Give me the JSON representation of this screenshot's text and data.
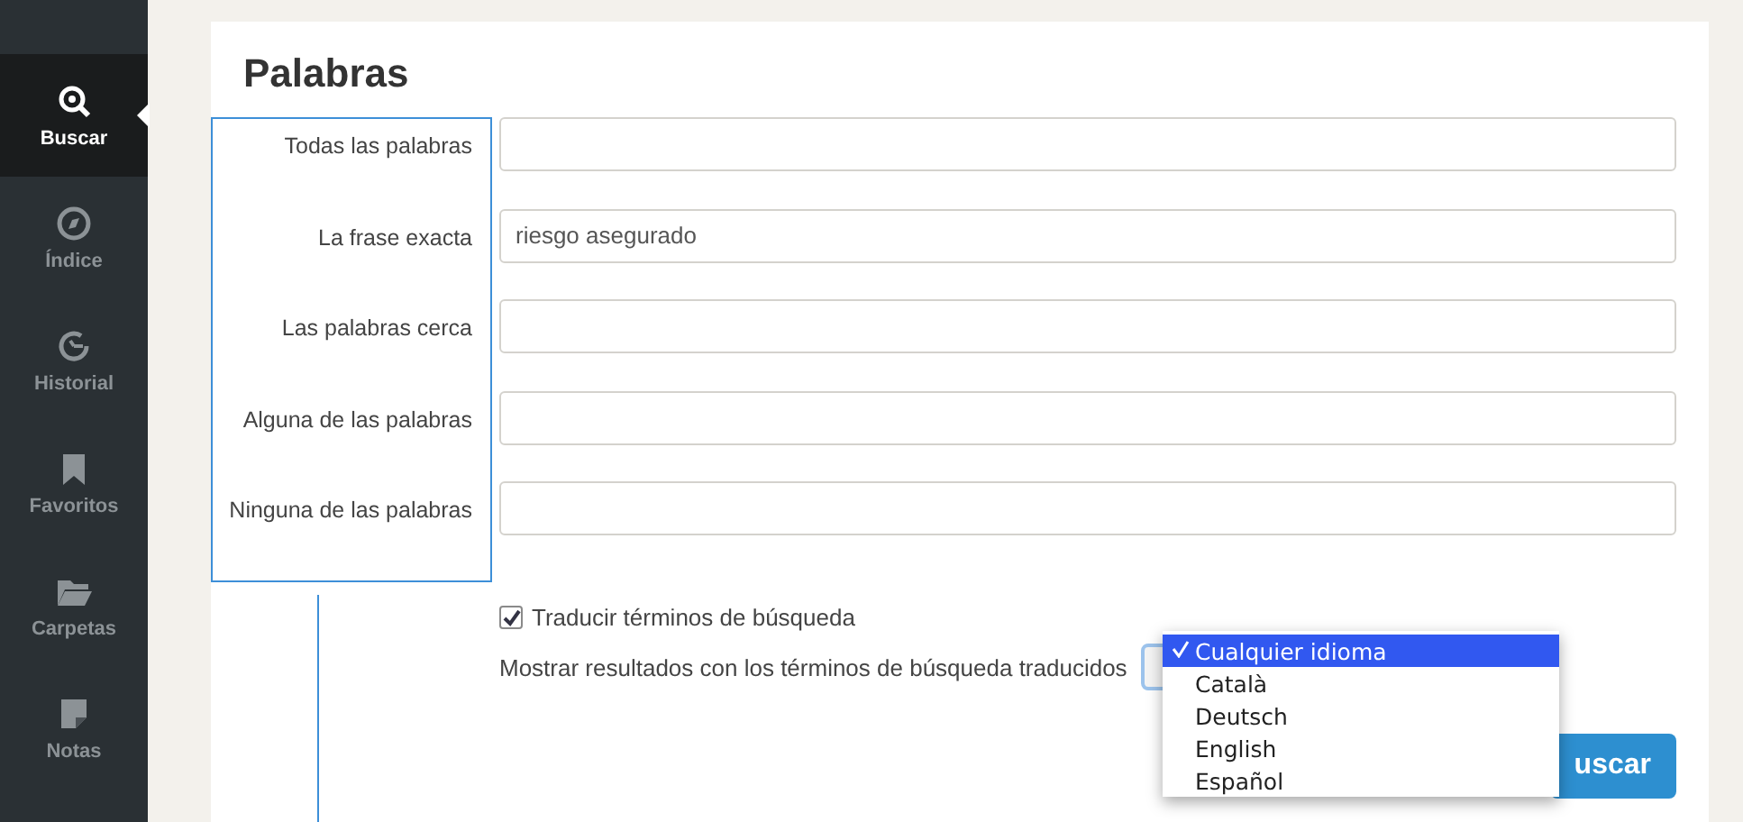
{
  "sidebar": {
    "items": [
      {
        "label": "Buscar",
        "selected": true
      },
      {
        "label": "Índice",
        "selected": false
      },
      {
        "label": "Historial",
        "selected": false
      },
      {
        "label": "Favoritos",
        "selected": false
      },
      {
        "label": "Carpetas",
        "selected": false
      },
      {
        "label": "Notas",
        "selected": false
      }
    ]
  },
  "section": {
    "title": "Palabras",
    "fields": [
      {
        "label": "Todas las palabras"
      },
      {
        "label": "La frase exacta",
        "value": "riesgo asegurado"
      },
      {
        "label": "Las palabras cerca"
      },
      {
        "label": "Alguna de las palabras"
      },
      {
        "label": "Ninguna de las palabras"
      }
    ],
    "translate": {
      "label": "Traducir términos de búsqueda",
      "checked": true
    },
    "language": {
      "label": "Mostrar resultados con los términos de búsqueda traducidos",
      "options": [
        {
          "label": "Cualquier idioma",
          "selected": true
        },
        {
          "label": "Català",
          "selected": false
        },
        {
          "label": "Deutsch",
          "selected": false
        },
        {
          "label": "English",
          "selected": false
        },
        {
          "label": "Español",
          "selected": false
        }
      ]
    },
    "submit": "uscar"
  }
}
